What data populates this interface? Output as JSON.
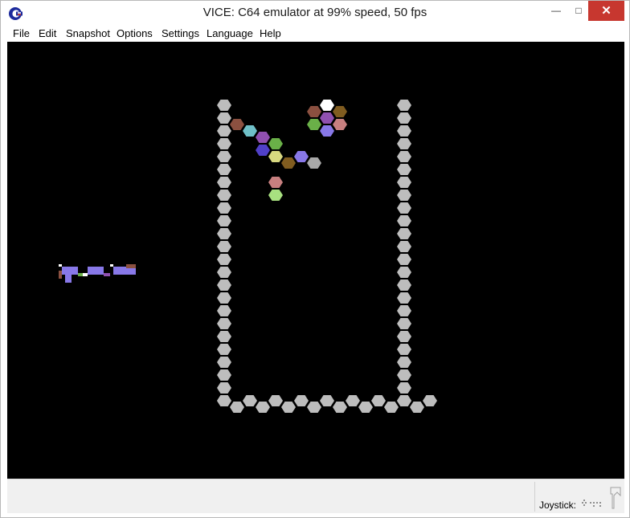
{
  "window": {
    "title": "VICE: C64 emulator at 99% speed, 50 fps",
    "controls": {
      "minimize": "—",
      "maximize": "□",
      "close": "✕"
    }
  },
  "menubar": {
    "items": [
      "File",
      "Edit",
      "Snapshot",
      "Options",
      "Settings",
      "Language",
      "Help"
    ]
  },
  "statusbar": {
    "joystick_label": "Joystick:"
  },
  "icons": {
    "app": "commodore-logo-icon",
    "joystick": "joystick-indicator-icon",
    "grip": "resize-grip-icon"
  },
  "colors": {
    "screen_bg": "#000000",
    "wall": "#bdbdbd",
    "close_button": "#c7372f",
    "c64_brown": "#8b5040",
    "c64_cyan": "#6fc0c8",
    "c64_purple": "#9050b0",
    "c64_green": "#6ab048",
    "c64_blue": "#5040c8",
    "c64_yellow": "#d8d880",
    "c64_orange_brown": "#805c20",
    "c64_light_blue": "#8878e8",
    "c64_grey": "#a8a8a8",
    "c64_light_red": "#c88080",
    "c64_light_green": "#a8e080",
    "c64_white": "#ffffff"
  }
}
